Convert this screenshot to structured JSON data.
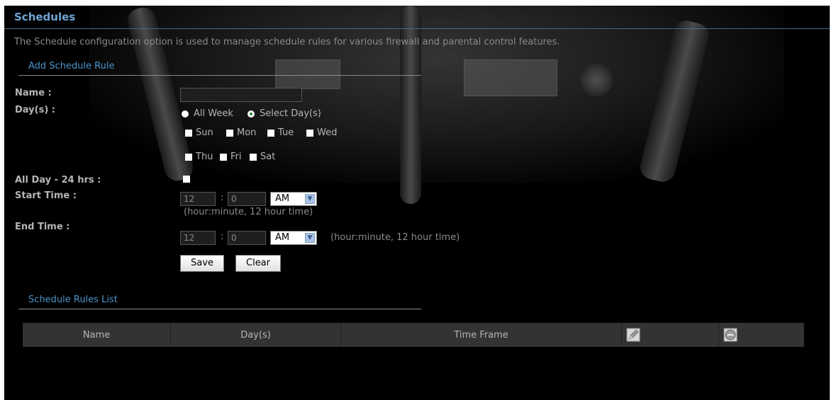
{
  "header": {
    "title": "Schedules",
    "description": "The Schedule configuration option is used to manage schedule rules for various firewall and parental control features."
  },
  "add_rule": {
    "section_title": "Add Schedule Rule",
    "name_label": "Name :",
    "name_value": "",
    "days_label": "Day(s) :",
    "all_week_label": "All Week",
    "select_days_label": "Select Day(s)",
    "selected_mode": "Select Day(s)",
    "days": [
      "Sun",
      "Mon",
      "Tue",
      "Wed",
      "Thu",
      "Fri",
      "Sat"
    ],
    "all_day_label": "All Day - 24 hrs :",
    "all_day_checked": false,
    "start_time_label": "Start Time :",
    "start_hour": "12",
    "start_minute": "0",
    "start_ampm": "AM",
    "time_sep": ":",
    "time_hint": "(hour:minute, 12 hour time)",
    "end_time_label": "End Time :",
    "end_hour": "12",
    "end_minute": "0",
    "end_ampm": "AM",
    "save_label": "Save",
    "clear_label": "Clear"
  },
  "rules_list": {
    "section_title": "Schedule Rules List",
    "columns": [
      "Name",
      "Day(s)",
      "Time Frame"
    ],
    "edit_icon": "edit-pencil-icon",
    "delete_icon": "delete-circle-icon"
  },
  "colors": {
    "accent": "#4b93c9",
    "title": "#6fa6d6",
    "background": "#000000",
    "table_header": "#333333"
  }
}
